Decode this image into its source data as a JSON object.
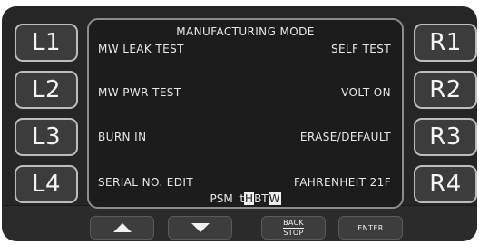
{
  "side_buttons": {
    "left": [
      "L1",
      "L2",
      "L3",
      "L4"
    ],
    "right": [
      "R1",
      "R2",
      "R3",
      "R4"
    ]
  },
  "screen": {
    "title": "MANUFACTURING MODE",
    "left_labels": [
      "MW LEAK TEST",
      "MW PWR TEST",
      "BURN IN",
      "SERIAL NO. EDIT"
    ],
    "right_labels": [
      "SELF TEST",
      "VOLT  ON",
      "ERASE/DEFAULT",
      "FAHRENHEIT 21F"
    ],
    "status": {
      "prefix": "PSM",
      "segments": [
        {
          "text": "t",
          "inverted": false
        },
        {
          "text": "H",
          "inverted": true
        },
        {
          "text": "BT",
          "inverted": false
        },
        {
          "text": "W",
          "inverted": true
        }
      ]
    }
  },
  "bottom_buttons": {
    "up_icon": "up-arrow-icon",
    "down_icon": "down-arrow-icon",
    "back_line1": "BACK",
    "back_line2": "STOP",
    "enter_label": "ENTER"
  },
  "colors": {
    "panel": "#262626",
    "button_fill": "#3c3c3c",
    "button_border": "#bdbdbd",
    "screen_bg": "#1c1c1c",
    "screen_border": "#8c8c8c",
    "text": "#e8e8e8"
  }
}
